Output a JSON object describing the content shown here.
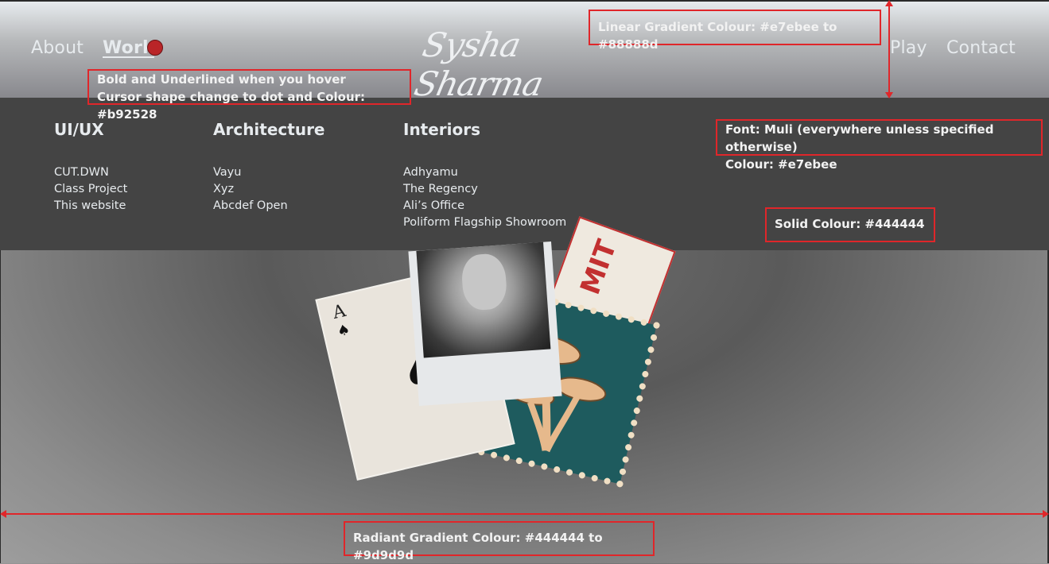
{
  "nav": {
    "about": "About",
    "work": "Work",
    "play": "Play",
    "contact": "Contact",
    "logo": "Sysha Sharma"
  },
  "dropdown": {
    "columns": [
      {
        "heading": "UI/UX",
        "items": [
          "CUT.DWN",
          "Class Project",
          "This website"
        ]
      },
      {
        "heading": "Architecture",
        "items": [
          "Vayu",
          "Xyz",
          "Abcdef Open"
        ]
      },
      {
        "heading": "Interiors",
        "items": [
          "Adhyamu",
          "The Regency",
          "Ali’s Office",
          "Poliform Flagship Showroom"
        ]
      }
    ]
  },
  "annotations": {
    "linear_gradient": "Linear Gradient Colour: #e7ebee to #88888d",
    "hover_line1": "Bold and Underlined when you hover",
    "hover_line2": "Cursor shape change to dot and Colour: #b92528",
    "font_line1": "Font: Muli (everywhere unless specified otherwise)",
    "font_line2": "Colour: #e7ebee",
    "solid": "Solid Colour: #444444",
    "radiant": "Radiant Gradient Colour: #444444 to #9d9d9d"
  },
  "collage": {
    "card_rank": "A",
    "ticket_text": "MIT"
  },
  "colors": {
    "header_gradient": [
      "#e7ebee",
      "#88888d"
    ],
    "dropdown_bg": "#444444",
    "text": "#e7ebee",
    "cursor": "#b92528",
    "bg_gradient": [
      "#444444",
      "#9d9d9d"
    ],
    "annotation": "#e0262a"
  },
  "icons": [
    "cursor-dot-icon",
    "spade-icon",
    "mushroom-icon"
  ]
}
